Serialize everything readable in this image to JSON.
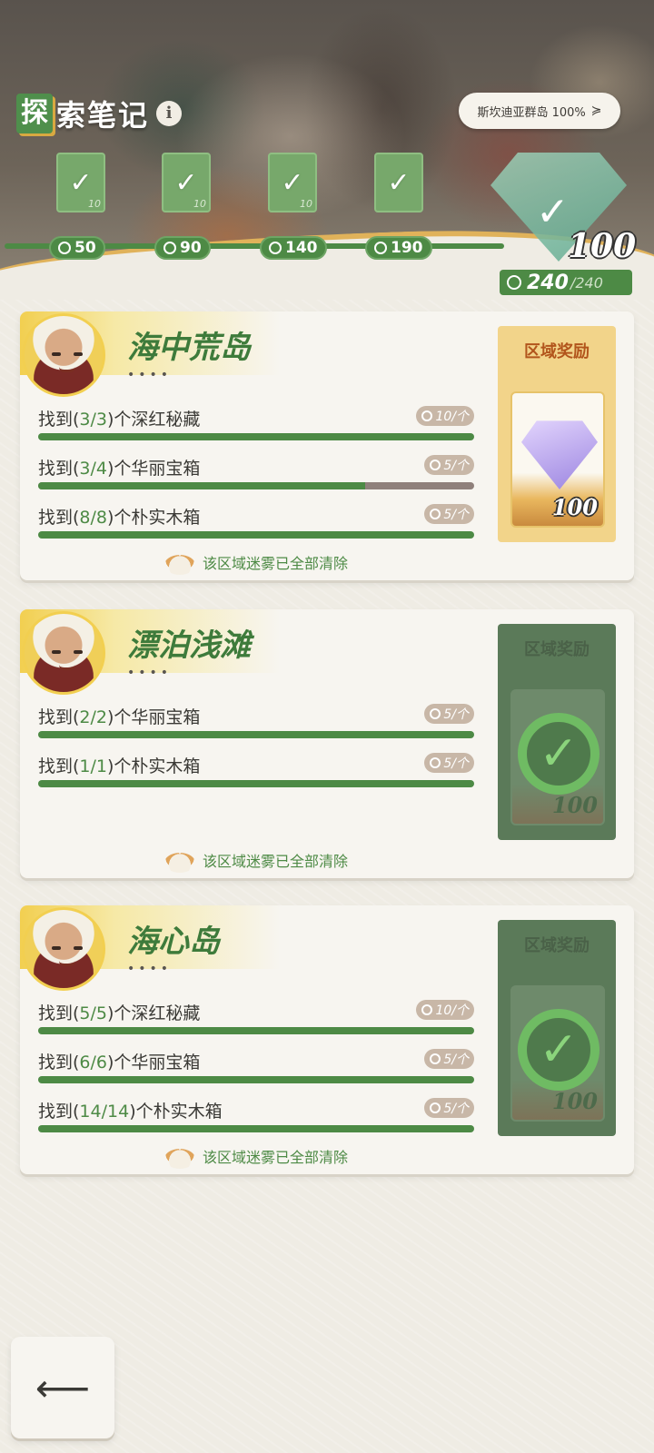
{
  "header": {
    "title_first_char": "探",
    "title_rest": "索笔记",
    "info_icon": "i",
    "region_selector": {
      "label": "斯坎迪亚群岛 100%",
      "icon": "chevron-down-icon"
    },
    "milestones": [
      {
        "value": "50",
        "count": "10"
      },
      {
        "value": "90",
        "count": "10"
      },
      {
        "value": "140",
        "count": "10"
      },
      {
        "value": "190",
        "count": ""
      }
    ],
    "big_reward": {
      "count": "100"
    },
    "total_progress": {
      "current": "240",
      "total": "/240"
    }
  },
  "areas": [
    {
      "name": "海中荒岛",
      "dots": "••••",
      "tasks": [
        {
          "prefix": "找到(",
          "found": "3/3",
          "suffix": ")个深红秘藏",
          "reward": "10/个",
          "progress": 1.0
        },
        {
          "prefix": "找到(",
          "found": "3/4",
          "suffix": ")个华丽宝箱",
          "reward": "5/个",
          "progress": 0.75
        },
        {
          "prefix": "找到(",
          "found": "8/8",
          "suffix": ")个朴实木箱",
          "reward": "5/个",
          "progress": 1.0
        }
      ],
      "fog_note": "该区域迷雾已全部清除",
      "reward_title": "区域奖励",
      "reward_count": "100",
      "reward_claimed": false
    },
    {
      "name": "漂泊浅滩",
      "dots": "••••",
      "tasks": [
        {
          "prefix": "找到(",
          "found": "2/2",
          "suffix": ")个华丽宝箱",
          "reward": "5/个",
          "progress": 1.0
        },
        {
          "prefix": "找到(",
          "found": "1/1",
          "suffix": ")个朴实木箱",
          "reward": "5/个",
          "progress": 1.0
        }
      ],
      "fog_note": "该区域迷雾已全部清除",
      "reward_title": "区域奖励",
      "reward_count": "100",
      "reward_claimed": true
    },
    {
      "name": "海心岛",
      "dots": "••••",
      "tasks": [
        {
          "prefix": "找到(",
          "found": "5/5",
          "suffix": ")个深红秘藏",
          "reward": "10/个",
          "progress": 1.0
        },
        {
          "prefix": "找到(",
          "found": "6/6",
          "suffix": ")个华丽宝箱",
          "reward": "5/个",
          "progress": 1.0
        },
        {
          "prefix": "找到(",
          "found": "14/14",
          "suffix": ")个朴实木箱",
          "reward": "5/个",
          "progress": 1.0
        }
      ],
      "fog_note": "该区域迷雾已全部清除",
      "reward_title": "区域奖励",
      "reward_count": "100",
      "reward_claimed": true
    }
  ],
  "back_button": {
    "icon": "back-arrow-icon",
    "glyph": "⟵"
  },
  "colors": {
    "accent_green": "#4d8a45",
    "gold": "#f2cf50",
    "claimed_green": "#5b7a59"
  }
}
